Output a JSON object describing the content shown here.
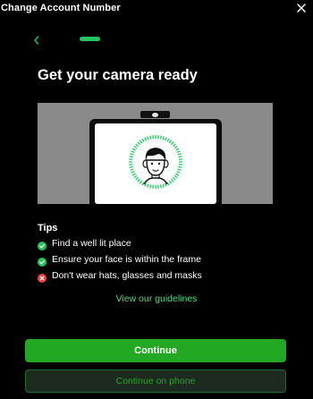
{
  "window": {
    "title": "Change Account Number",
    "close_icon": "close-icon"
  },
  "nav": {
    "back_icon": "chevron-left-icon",
    "progress_color": "#22c55e"
  },
  "heading": "Get your camera ready",
  "illustration": {
    "description_icon": "laptop-face-icon"
  },
  "tips": {
    "title": "Tips",
    "items": [
      {
        "label": "Find a well lit place",
        "status": "ok",
        "icon": "check-circle-icon"
      },
      {
        "label": "Ensure your face is within the frame",
        "status": "ok",
        "icon": "check-circle-icon"
      },
      {
        "label": "Don't wear hats, glasses and masks",
        "status": "bad",
        "icon": "x-circle-icon"
      }
    ]
  },
  "guidelines_link": "View our guidelines",
  "buttons": {
    "continue": "Continue",
    "continue_on_phone": "Continue on phone"
  },
  "colors": {
    "accent": "#22a822",
    "ok": "#22c55e",
    "bad": "#ef4444",
    "link": "#4ade80"
  }
}
